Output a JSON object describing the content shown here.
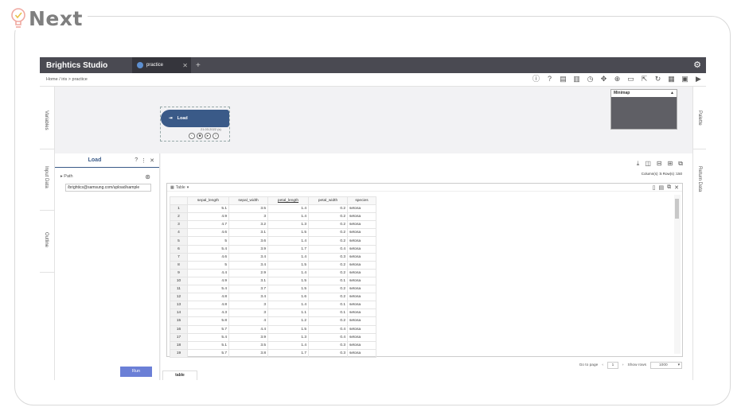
{
  "slide": {
    "logo_text": "Next"
  },
  "app": {
    "brand": "Brightics Studio",
    "tab": {
      "label": "practice",
      "close": "✕"
    },
    "tab_add": "+",
    "settings_icon": "gear-icon"
  },
  "toolbar": {
    "breadcrumb": "Home / iris > practice",
    "icons": [
      "info-icon",
      "help-icon",
      "copy-icon",
      "paste-icon",
      "clock-icon",
      "move-icon",
      "zoom-icon",
      "new-icon",
      "export-icon",
      "refresh-icon",
      "save-icon",
      "calendar-icon",
      "run-icon"
    ]
  },
  "left_tabs": {
    "variables": "Variables",
    "input_data": "Input Data",
    "outline": "Outline"
  },
  "right_tabs": {
    "palette": "Palette",
    "return_data": "Return Data"
  },
  "canvas": {
    "node": {
      "label": "Load",
      "subtitle": "21.03.2022 (s)"
    },
    "minimap": {
      "title": "Minimap",
      "toggle": "▲"
    }
  },
  "input_panel": {
    "title": "Load",
    "path_label": "Path",
    "path_value": "/brightics@samsung.com/upload/sample",
    "run_label": "Run"
  },
  "result": {
    "count_text": "Column(s) :5   Row(s) :150",
    "grid_title": "Table",
    "columns": [
      "sepal_length",
      "sepal_width",
      "petal_length",
      "petal_width",
      "species"
    ],
    "rows": [
      [
        1,
        "5.1",
        "3.5",
        "1.4",
        "0.2",
        "setosa"
      ],
      [
        2,
        "4.9",
        "3",
        "1.4",
        "0.2",
        "setosa"
      ],
      [
        3,
        "4.7",
        "3.2",
        "1.3",
        "0.2",
        "setosa"
      ],
      [
        4,
        "4.6",
        "3.1",
        "1.5",
        "0.2",
        "setosa"
      ],
      [
        5,
        "5",
        "3.6",
        "1.4",
        "0.2",
        "setosa"
      ],
      [
        6,
        "5.4",
        "3.9",
        "1.7",
        "0.4",
        "setosa"
      ],
      [
        7,
        "4.6",
        "3.4",
        "1.4",
        "0.3",
        "setosa"
      ],
      [
        8,
        "5",
        "3.4",
        "1.5",
        "0.2",
        "setosa"
      ],
      [
        9,
        "4.4",
        "2.9",
        "1.4",
        "0.2",
        "setosa"
      ],
      [
        10,
        "4.9",
        "3.1",
        "1.5",
        "0.1",
        "setosa"
      ],
      [
        11,
        "5.4",
        "3.7",
        "1.5",
        "0.2",
        "setosa"
      ],
      [
        12,
        "4.8",
        "3.4",
        "1.6",
        "0.2",
        "setosa"
      ],
      [
        13,
        "4.8",
        "3",
        "1.4",
        "0.1",
        "setosa"
      ],
      [
        14,
        "4.3",
        "3",
        "1.1",
        "0.1",
        "setosa"
      ],
      [
        15,
        "5.8",
        "4",
        "1.2",
        "0.2",
        "setosa"
      ],
      [
        16,
        "5.7",
        "4.4",
        "1.5",
        "0.4",
        "setosa"
      ],
      [
        17,
        "5.4",
        "3.9",
        "1.3",
        "0.4",
        "setosa"
      ],
      [
        18,
        "5.1",
        "3.5",
        "1.4",
        "0.3",
        "setosa"
      ],
      [
        19,
        "5.7",
        "3.8",
        "1.7",
        "0.3",
        "setosa"
      ]
    ],
    "pager": {
      "goto_label": "Go to page",
      "page": "1",
      "show_rows_label": "Show rows",
      "rows_value": "1000"
    },
    "bottom_tab": "table"
  }
}
